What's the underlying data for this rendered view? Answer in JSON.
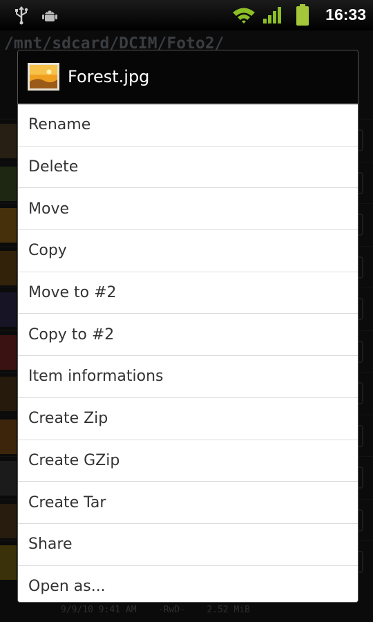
{
  "status_bar": {
    "time": "16:33",
    "icons": [
      "usb-icon",
      "android-debug-icon",
      "wifi-icon",
      "signal-icon",
      "battery-icon"
    ],
    "accent_color": "#a4c639"
  },
  "background_app": {
    "path": "/mnt/sdcard/DCIM/Foto2/",
    "footer_text": "9/9/10 9:41 AM    -RwD-    2.52 MiB"
  },
  "dialog": {
    "title": "Forest.jpg",
    "icon": "image-file-icon",
    "items": [
      {
        "label": "Rename"
      },
      {
        "label": "Delete"
      },
      {
        "label": "Move"
      },
      {
        "label": "Copy"
      },
      {
        "label": "Move to #2"
      },
      {
        "label": "Copy to #2"
      },
      {
        "label": "Item informations"
      },
      {
        "label": "Create Zip"
      },
      {
        "label": "Create GZip"
      },
      {
        "label": "Create Tar"
      },
      {
        "label": "Share"
      },
      {
        "label": "Open as..."
      }
    ]
  }
}
